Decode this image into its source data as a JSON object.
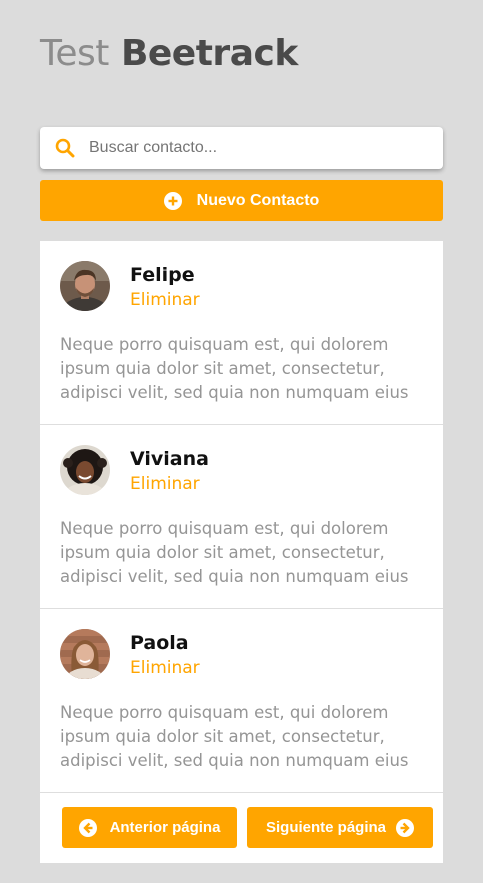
{
  "header": {
    "title_light": "Test",
    "title_bold": "Beetrack"
  },
  "search": {
    "placeholder": "Buscar contacto...",
    "value": "",
    "icon": "search-icon"
  },
  "new_contact": {
    "label": "Nuevo Contacto",
    "icon": "plus-circle-icon"
  },
  "contacts": [
    {
      "name": "Felipe",
      "action": "Eliminar",
      "description": "Neque porro quisquam est, qui dolorem ipsum quia dolor sit amet, consectetur, adipisci velit, sed quia non numquam eius"
    },
    {
      "name": "Viviana",
      "action": "Eliminar",
      "description": "Neque porro quisquam est, qui dolorem ipsum quia dolor sit amet, consectetur, adipisci velit, sed quia non numquam eius"
    },
    {
      "name": "Paola",
      "action": "Eliminar",
      "description": "Neque porro quisquam est, qui dolorem ipsum quia dolor sit amet, consectetur, adipisci velit, sed quia non numquam eius"
    }
  ],
  "pagination": {
    "prev_label": "Anterior página",
    "next_label": "Siguiente página"
  },
  "colors": {
    "accent": "#ffa500",
    "background": "#dcdcdc",
    "card": "#ffffff",
    "description_text": "#959595"
  }
}
